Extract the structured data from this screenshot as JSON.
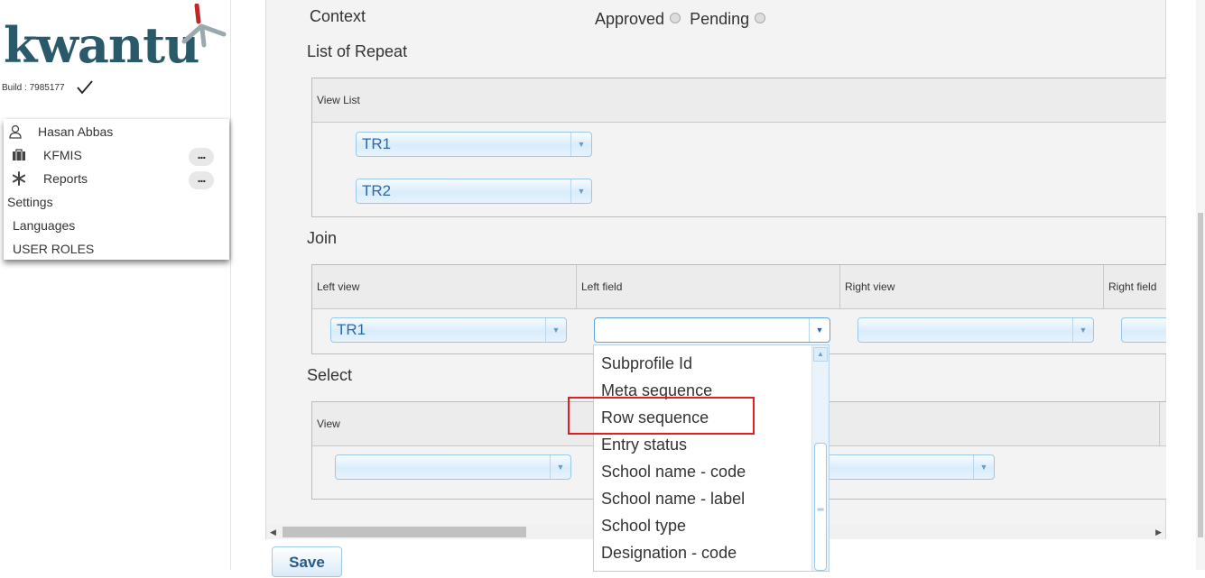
{
  "brand": {
    "logo_text": "kwantu",
    "accent_color": "#c0272d",
    "primary_color": "#2a5a6a"
  },
  "build": {
    "label": "Build : 7985177",
    "status_icon": "check-icon"
  },
  "sidebar": {
    "user": {
      "icon": "user-icon",
      "label": "Hasan Abbas"
    },
    "items": [
      {
        "icon": "briefcase-icon",
        "label": "KFMIS",
        "more": "..."
      },
      {
        "icon": "snowflake-icon",
        "label": "Reports",
        "more": "..."
      }
    ],
    "settings": "Settings",
    "languages": "Languages",
    "user_roles": "USER ROLES"
  },
  "form": {
    "context_label": "Context",
    "status_options": [
      "Approved",
      "Pending"
    ],
    "list_of_repeat": {
      "title": "List of Repeat",
      "header": "View List",
      "values": [
        "TR1",
        "TR2"
      ]
    },
    "join": {
      "title": "Join",
      "headers": [
        "Left view",
        "Left field",
        "Right view",
        "Right field"
      ],
      "left_view_value": "TR1",
      "left_field_value": "",
      "right_view_value": "",
      "right_field_value": ""
    },
    "select": {
      "title": "Select",
      "headers": [
        "View",
        ""
      ],
      "view_value": "",
      "field_value": ""
    },
    "dropdown_options": [
      "Subprofile Id",
      "Meta sequence",
      "Row sequence",
      "Entry status",
      "School name - code",
      "School name - label",
      "School type",
      "Designation - code"
    ],
    "highlighted_option": "Row sequence",
    "save_label": "Save"
  }
}
